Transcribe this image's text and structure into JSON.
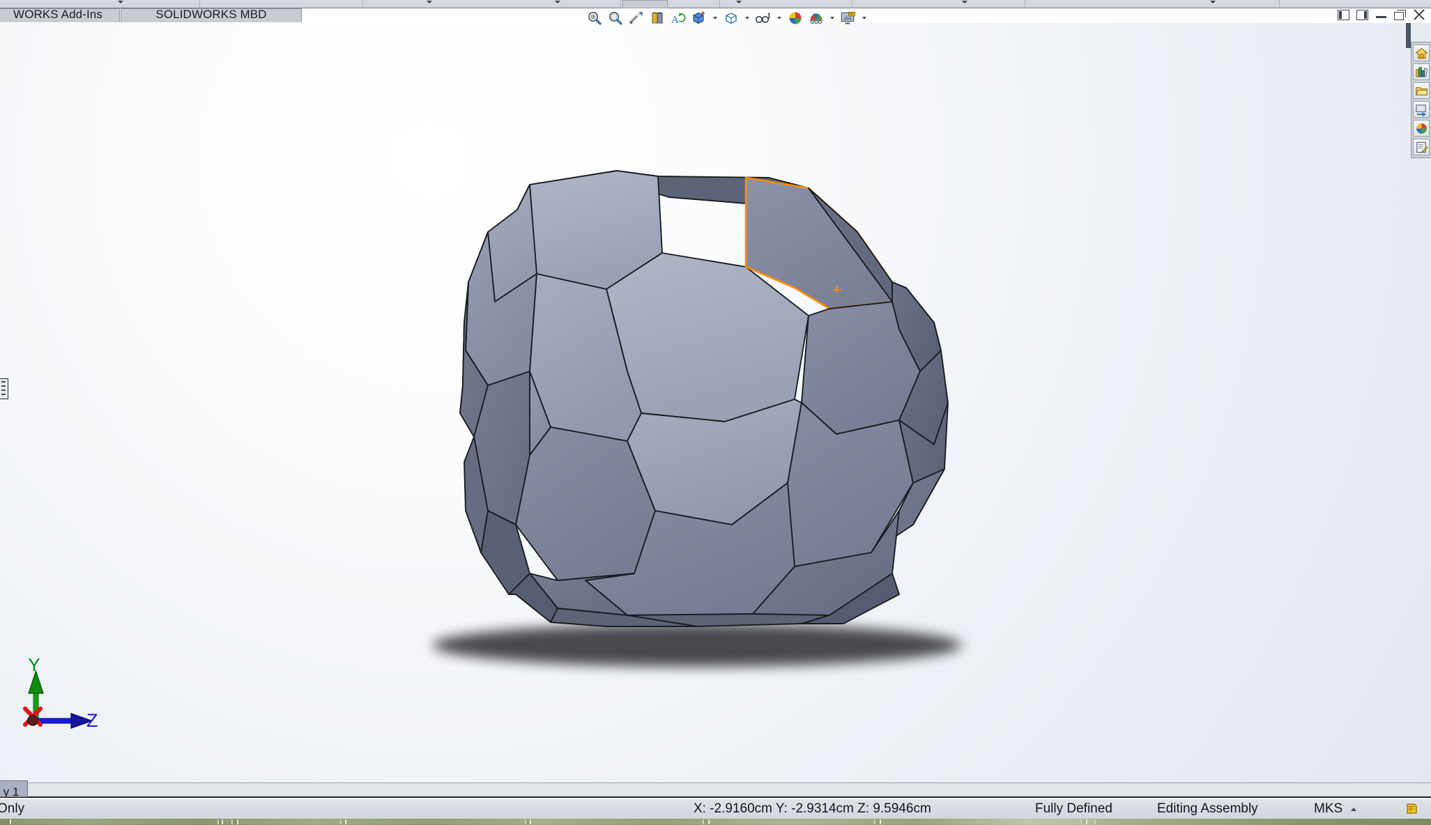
{
  "window": {
    "controls": [
      {
        "name": "collapse-left-panel",
        "icon": "panel-left-icon"
      },
      {
        "name": "collapse-right-panel",
        "icon": "panel-right-icon"
      },
      {
        "name": "minimize",
        "icon": "minimize-icon"
      },
      {
        "name": "restore",
        "icon": "restore-icon"
      },
      {
        "name": "close",
        "icon": "close-icon"
      }
    ]
  },
  "ribbon": {
    "caret_positions": [
      173,
      616,
      800,
      1060,
      1384,
      1740
    ],
    "separator_positions": [
      286,
      520,
      890,
      1032,
      1222,
      1470,
      1835
    ],
    "ghost_button_label": ""
  },
  "command_tabs": [
    {
      "label": "WORKS Add-Ins",
      "active": false
    },
    {
      "label": "SOLIDWORKS MBD",
      "active": false
    }
  ],
  "view_toolbar": {
    "items": [
      {
        "label": "Zoom to Fit",
        "icon": "zoom-to-fit-icon",
        "caret": false
      },
      {
        "label": "Zoom to Area",
        "icon": "zoom-to-area-icon",
        "caret": false
      },
      {
        "label": "Previous View",
        "icon": "previous-view-icon",
        "caret": false
      },
      {
        "label": "Section View",
        "icon": "section-view-icon",
        "caret": false
      },
      {
        "label": "View Orientation",
        "icon": "view-orientation-icon",
        "caret": false
      },
      {
        "label": "Display Style",
        "icon": "display-style-icon",
        "caret": true
      },
      {
        "label": "Hide/Show Items",
        "icon": "hide-show-items-icon",
        "caret": true
      },
      {
        "label": "Edit Appearance",
        "icon": "edit-appearance-icon",
        "caret": true
      },
      {
        "label": "Apply Scene",
        "icon": "apply-scene-icon",
        "caret": true
      },
      {
        "label": "View Settings",
        "icon": "view-settings-icon",
        "caret": true
      }
    ]
  },
  "task_pane": {
    "items": [
      {
        "label": "SOLIDWORKS Resources",
        "icon": "home-icon"
      },
      {
        "label": "Design Library",
        "icon": "design-library-icon"
      },
      {
        "label": "File Explorer",
        "icon": "folder-icon"
      },
      {
        "label": "View Palette",
        "icon": "view-palette-icon"
      },
      {
        "label": "Appearances, Scenes and Decals",
        "icon": "appearances-icon"
      },
      {
        "label": "Custom Properties",
        "icon": "custom-properties-icon"
      }
    ]
  },
  "viewport": {
    "triad": {
      "y_label": "Y",
      "z_label": "Z",
      "x_label": "X",
      "y_color": "#00921f",
      "z_color": "#1919e6",
      "x_color": "#e01414"
    },
    "model": {
      "name": "truncated-icosahedron",
      "face_fill_light": "#a3a9bd",
      "face_fill_mid": "#8f96ab",
      "face_fill_dark": "#767d92",
      "face_fill_darker": "#646b80",
      "edge_color": "#1b1d22",
      "highlight_color": "#ff8c00",
      "highlighted_face": "hexagon-upper-right",
      "face_center_marker": "+"
    },
    "background_top": "#ffffff",
    "background_bottom": "#e3e8f0",
    "shadow_color": "#3a3b3f"
  },
  "bottom_tab": {
    "label": "y 1"
  },
  "status_bar": {
    "read_only": "Only",
    "coordinates": "X: -2.9160cm Y: -2.9314cm Z: 9.5946cm",
    "coordinate_values": {
      "x": "-2.9160cm",
      "y": "-2.9314cm",
      "z": "9.5946cm"
    },
    "defined_state": "Fully Defined",
    "edit_mode": "Editing Assembly",
    "units": "MKS",
    "note_icon": "note-icon"
  }
}
